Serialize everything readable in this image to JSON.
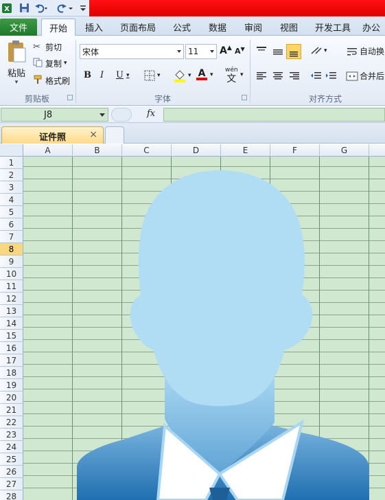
{
  "app": {
    "accent_red": "#e00000",
    "file_tab_color": "#2a8a37",
    "cell_fill": "#cfe8cf",
    "silhouette_color": "#b0dcf4",
    "suit_color": "#2f7fbf"
  },
  "quick_access": {
    "icons": [
      "excel-icon",
      "save-icon",
      "undo-icon",
      "redo-icon",
      "customize-icon"
    ]
  },
  "tabs": [
    {
      "label": "文件"
    },
    {
      "label": "开始"
    },
    {
      "label": "插入"
    },
    {
      "label": "页面布局"
    },
    {
      "label": "公式"
    },
    {
      "label": "数据"
    },
    {
      "label": "审阅"
    },
    {
      "label": "视图"
    },
    {
      "label": "开发工具"
    },
    {
      "label": "办公"
    }
  ],
  "ribbon": {
    "clipboard": {
      "paste": "粘贴",
      "cut": "剪切",
      "copy": "复制",
      "format_painter": "格式刷",
      "group": "剪贴板"
    },
    "font": {
      "family": "宋体",
      "size": "11",
      "bold": "B",
      "italic": "I",
      "underline": "U",
      "grow": "A",
      "shrink": "A",
      "phonetic": "wén",
      "phonetic_char": "文",
      "font_color": "A",
      "group": "字体"
    },
    "alignment": {
      "wrap": "自动换",
      "merge": "合并后",
      "group": "对齐方式"
    }
  },
  "formula_bar": {
    "cell_ref": "J8",
    "fx": "fx"
  },
  "workbook": {
    "tab_name": "证件照",
    "close": "×"
  },
  "sheet": {
    "columns": [
      "A",
      "B",
      "C",
      "D",
      "E",
      "F",
      "G"
    ],
    "rows": [
      "1",
      "2",
      "3",
      "4",
      "5",
      "6",
      "7",
      "8",
      "9",
      "10",
      "11",
      "12",
      "13",
      "14",
      "15",
      "16",
      "17",
      "18",
      "19",
      "20",
      "21",
      "22",
      "23",
      "24",
      "25",
      "26",
      "27",
      "28"
    ],
    "selected_row": "8"
  }
}
